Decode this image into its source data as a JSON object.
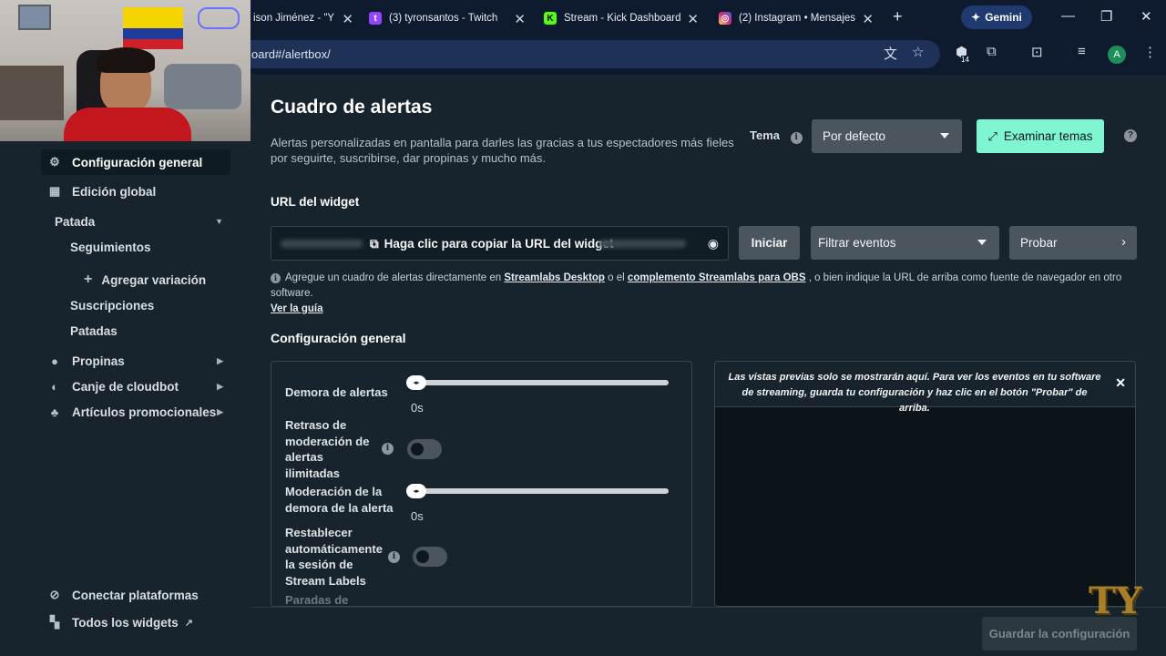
{
  "browser": {
    "tabs": [
      {
        "title": "ison Jiménez - \"Y",
        "icon": "generic-tab-icon",
        "color": "#0e1a2e"
      },
      {
        "title": "(3) tyronsantos - Twitch",
        "icon": "twitch-icon",
        "color": "#9146ff"
      },
      {
        "title": "Stream - Kick Dashboard",
        "icon": "kick-icon",
        "color": "#53fc18"
      },
      {
        "title": "(2) Instagram • Mensajes",
        "icon": "instagram-icon",
        "color": "#d62976"
      }
    ],
    "gemini_label": "Gemini",
    "url": "oard#/alertbox/",
    "extension_badge": "14",
    "avatar_letter": "A"
  },
  "sidebar": {
    "items": [
      {
        "label": "Configuración general",
        "icon": "gear-icon"
      },
      {
        "label": "Edición global",
        "icon": "grid-icon"
      },
      {
        "label": "Patada"
      },
      {
        "label": "Seguimientos"
      },
      {
        "label": "Agregar variación",
        "icon": "plus-icon"
      },
      {
        "label": "Suscripciones"
      },
      {
        "label": "Patadas"
      },
      {
        "label": "Propinas",
        "icon": "coins-icon"
      },
      {
        "label": "Canje de cloudbot",
        "icon": "cloudbot-icon"
      },
      {
        "label": "Artículos promocionales",
        "icon": "merch-icon"
      }
    ],
    "bottom": [
      {
        "label": "Conectar plataformas",
        "icon": "link-icon"
      },
      {
        "label": "Todos los widgets",
        "icon": "widgets-icon"
      }
    ]
  },
  "main": {
    "title": "Cuadro de alertas",
    "description": "Alertas personalizadas en pantalla para darles las gracias a tus espectadores más fieles por seguirte, suscribirse, dar propinas y mucho más.",
    "theme_label": "Tema",
    "theme_value": "Por defecto",
    "explore_button": "Examinar temas",
    "widget_url_title": "URL del widget",
    "copy_url": "Haga clic para copiar la URL del widget",
    "start_button": "Iniciar",
    "filter_events": "Filtrar eventos",
    "test_button": "Probar",
    "note_1": "Agregue un cuadro de alertas directamente en",
    "note_link_1": "Streamlabs Desktop",
    "note_2": "o el",
    "note_link_2": "complemento Streamlabs para OBS",
    "note_3": ", o bien indique la URL de arriba como fuente de navegador en otro software.",
    "note_link_3": "Ver la guía",
    "general_title": "Configuración general",
    "settings": {
      "alert_delay": {
        "label": "Demora de alertas",
        "value": "0s"
      },
      "moderation_delay": {
        "label": "Retraso de moderación de alertas ilimitadas"
      },
      "alert_moderation": {
        "label": "Moderación de la demora de la alerta",
        "value": "0s"
      },
      "reset_session": {
        "label": "Restablecer automáticamente la sesión de Stream Labels"
      },
      "stops": {
        "label": "Paradas de"
      }
    },
    "preview_message": "Las vistas previas solo se mostrarán aquí. Para ver los eventos en tu software de streaming, guarda tu configuración y haz clic en el botón \"Probar\" de arriba.",
    "save_button": "Guardar la configuración"
  },
  "watermark": "TY",
  "colors": {
    "accent": "#80f5d2",
    "background": "#17242d",
    "browser": "#0e1a2e"
  }
}
